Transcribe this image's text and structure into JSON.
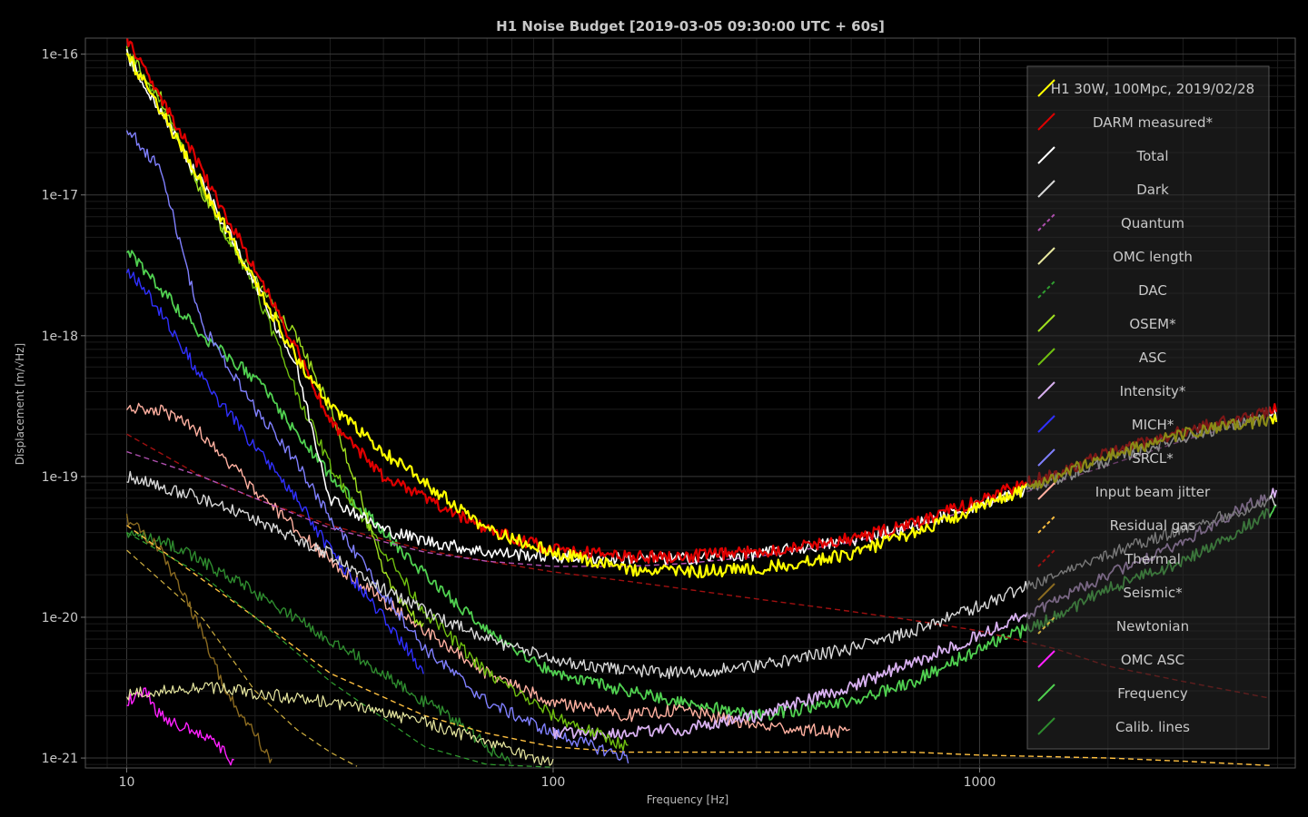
{
  "chart_data": {
    "type": "line",
    "title": "H1 Noise Budget [2019-03-05 09:30:00 UTC + 60s]",
    "xlabel": "Frequency [Hz]",
    "ylabel": "Displacement [m/√Hz]",
    "xscale": "log",
    "yscale": "log",
    "xlim": [
      8,
      5500
    ],
    "ylim": [
      8.5e-22,
      1.3e-16
    ],
    "grid": true,
    "legend_position": "right",
    "xticks": [
      {
        "value": 10,
        "label": "10"
      },
      {
        "value": 100,
        "label": "100"
      },
      {
        "value": 1000,
        "label": "1000"
      }
    ],
    "yticks": [
      {
        "value": 1e-21,
        "label": "1e-21"
      },
      {
        "value": 1e-20,
        "label": "1e-20"
      },
      {
        "value": 1e-19,
        "label": "1e-19"
      },
      {
        "value": 1e-18,
        "label": "1e-18"
      },
      {
        "value": 1e-17,
        "label": "1e-17"
      },
      {
        "value": 1e-16,
        "label": "1e-16"
      }
    ],
    "series": [
      {
        "name": "H1 30W, 100Mpc, 2019/02/28",
        "color": "#ffff00",
        "style": "solid",
        "width": 2.2,
        "x": [
          10,
          12,
          15,
          20,
          25,
          30,
          40,
          50,
          70,
          100,
          150,
          200,
          300,
          500,
          700,
          1000,
          1500,
          2000,
          3000,
          5000
        ],
        "y": [
          1e-16,
          4e-17,
          1.2e-17,
          2.4e-18,
          7e-19,
          3.2e-19,
          1.5e-19,
          9e-20,
          4.2e-20,
          2.9e-20,
          2.2e-20,
          2.1e-20,
          2.2e-20,
          2.8e-20,
          4e-20,
          6e-20,
          1e-19,
          1.4e-19,
          2e-19,
          2.6e-19
        ]
      },
      {
        "name": "DARM measured*",
        "color": "#e00000",
        "style": "solid",
        "width": 2.2,
        "x": [
          10,
          12,
          15,
          20,
          25,
          30,
          40,
          50,
          70,
          100,
          150,
          200,
          300,
          500,
          700,
          1000,
          1500,
          2000,
          3000,
          5000
        ],
        "y": [
          1.3e-16,
          5e-17,
          1.5e-17,
          3e-18,
          8e-19,
          2.5e-19,
          1e-19,
          7e-20,
          4.2e-20,
          3e-20,
          2.7e-20,
          2.7e-20,
          2.9e-20,
          3.6e-20,
          4.6e-20,
          6.8e-20,
          1.05e-19,
          1.45e-19,
          2.1e-19,
          3e-19
        ]
      },
      {
        "name": "Total",
        "color": "#ffffff",
        "style": "solid",
        "width": 1.6,
        "x": [
          10,
          15,
          20,
          25,
          30,
          40,
          50,
          70,
          100,
          150,
          200,
          300,
          500,
          700,
          1000,
          1500,
          2000,
          3000,
          5000
        ],
        "y": [
          1e-16,
          1.2e-17,
          2.4e-18,
          6e-19,
          7e-20,
          4.2e-20,
          3.5e-20,
          2.9e-20,
          2.7e-20,
          2.6e-20,
          2.6e-20,
          2.8e-20,
          3.5e-20,
          4.5e-20,
          6.3e-20,
          9.5e-20,
          1.3e-19,
          1.9e-19,
          2.8e-19
        ]
      },
      {
        "name": "Dark",
        "color": "#d8d8d8",
        "style": "solid",
        "width": 1.4,
        "x": [
          10,
          15,
          20,
          30,
          40,
          50,
          70,
          100,
          150,
          200,
          300,
          500,
          700,
          1000,
          1500,
          2000,
          3000,
          5000
        ],
        "y": [
          1e-19,
          7e-20,
          5e-20,
          2.8e-20,
          1.6e-20,
          1.1e-20,
          7e-21,
          5e-21,
          4.2e-21,
          4e-21,
          4.5e-21,
          6e-21,
          8e-21,
          1.2e-20,
          2e-20,
          2.8e-20,
          4.2e-20,
          7e-20
        ]
      },
      {
        "name": "Quantum",
        "color": "#b050b0",
        "style": "dashed",
        "width": 1.4,
        "x": [
          10,
          15,
          20,
          30,
          50,
          70,
          100,
          150,
          200,
          300,
          500,
          700,
          1000,
          1500,
          2000,
          3000,
          5000
        ],
        "y": [
          1.5e-19,
          1e-19,
          7e-20,
          4.3e-20,
          2.9e-20,
          2.5e-20,
          2.3e-20,
          2.3e-20,
          2.4e-20,
          2.7e-20,
          3.4e-20,
          4.4e-20,
          6.1e-20,
          9e-20,
          1.2e-19,
          1.8e-19,
          2.8e-19
        ]
      },
      {
        "name": "OMC length",
        "color": "#e8e8a0",
        "style": "solid",
        "width": 1.2,
        "x": [
          10,
          12,
          15,
          20,
          30,
          50,
          70,
          100
        ],
        "y": [
          2.8e-21,
          3e-21,
          3.2e-21,
          2.9e-21,
          2.5e-21,
          1.8e-21,
          1.3e-21,
          9e-22
        ]
      },
      {
        "name": "DAC",
        "color": "#30a030",
        "style": "dashed",
        "width": 1.2,
        "x": [
          10,
          15,
          20,
          30,
          50,
          70,
          100
        ],
        "y": [
          4e-20,
          2e-20,
          1e-20,
          3.5e-21,
          1.2e-21,
          9e-22,
          8.6e-22
        ]
      },
      {
        "name": "OSEM*",
        "color": "#a0e020",
        "style": "solid",
        "width": 1.4,
        "x": [
          10,
          12,
          15,
          20,
          25,
          30,
          35,
          40,
          50
        ],
        "y": [
          1.1e-16,
          5e-17,
          1e-17,
          2.5e-18,
          1e-18,
          3e-19,
          8e-20,
          2e-20,
          8e-21
        ]
      },
      {
        "name": "ASC",
        "color": "#70c010",
        "style": "solid",
        "width": 1.4,
        "x": [
          10,
          12,
          15,
          20,
          25,
          30,
          40,
          50,
          70,
          100,
          150
        ],
        "y": [
          1e-16,
          4.5e-17,
          1.1e-17,
          2.2e-18,
          4e-19,
          1.2e-19,
          3e-20,
          1.1e-20,
          4e-21,
          2e-21,
          1.2e-21
        ]
      },
      {
        "name": "Intensity*",
        "color": "#d8b0f0",
        "style": "solid",
        "width": 1.8,
        "x": [
          100,
          150,
          200,
          300,
          500,
          700,
          1000,
          1500,
          2000,
          3000,
          5000
        ],
        "y": [
          1.5e-21,
          1.5e-21,
          1.6e-21,
          2e-21,
          3.2e-21,
          4.8e-21,
          7.5e-21,
          1.3e-20,
          2e-20,
          3.5e-20,
          8e-20
        ]
      },
      {
        "name": "MICH*",
        "color": "#3030ff",
        "style": "solid",
        "width": 1.4,
        "x": [
          10,
          12,
          15,
          20,
          25,
          30,
          40,
          50
        ],
        "y": [
          3e-18,
          1.5e-18,
          5e-19,
          1.6e-19,
          7e-20,
          3e-20,
          1e-20,
          4e-21
        ]
      },
      {
        "name": "SRCL*",
        "color": "#8080ff",
        "style": "solid",
        "width": 1.4,
        "x": [
          10,
          12,
          15,
          20,
          25,
          30,
          40,
          50,
          70,
          100,
          150
        ],
        "y": [
          3e-17,
          1.5e-17,
          1.2e-18,
          3e-19,
          1.3e-19,
          5e-20,
          1.5e-20,
          6e-21,
          2.5e-21,
          1.5e-21,
          1e-21
        ]
      },
      {
        "name": "Input beam jitter",
        "color": "#ffb0a0",
        "style": "solid",
        "width": 1.4,
        "x": [
          10,
          12,
          15,
          20,
          30,
          50,
          70,
          100,
          150,
          200,
          300,
          500
        ],
        "y": [
          3e-19,
          3e-19,
          2e-19,
          8e-20,
          2.5e-20,
          8e-21,
          4e-21,
          2.5e-21,
          2e-21,
          2.2e-21,
          1.7e-21,
          1.5e-21
        ]
      },
      {
        "name": "Residual gas",
        "color": "#ffc040",
        "style": "dashed",
        "width": 1.4,
        "x": [
          10,
          20,
          30,
          50,
          70,
          100,
          150,
          200,
          300,
          500,
          700,
          1000,
          2000,
          3000,
          5000
        ],
        "y": [
          4.5e-20,
          1e-20,
          4e-21,
          2e-21,
          1.5e-21,
          1.2e-21,
          1.1e-21,
          1.1e-21,
          1.1e-21,
          1.1e-21,
          1.1e-21,
          1.05e-21,
          1e-21,
          9.5e-22,
          8.8e-22
        ]
      },
      {
        "name": "Thermal",
        "color": "#a01010",
        "style": "dashed",
        "width": 1.4,
        "x": [
          10,
          15,
          20,
          30,
          50,
          70,
          100,
          150,
          200,
          300,
          500,
          700,
          1000,
          1500,
          2000,
          3000,
          5000
        ],
        "y": [
          2e-19,
          1e-19,
          7e-20,
          4.5e-20,
          3e-20,
          2.5e-20,
          2.1e-20,
          1.8e-20,
          1.6e-20,
          1.35e-20,
          1.1e-20,
          9.5e-21,
          8e-21,
          6e-21,
          4.5e-21,
          3.5e-21,
          2.6e-21
        ]
      },
      {
        "name": "Seismic*",
        "color": "#8a6a20",
        "style": "solid",
        "width": 1.4,
        "x": [
          10,
          12,
          15,
          17,
          20,
          22
        ],
        "y": [
          5e-20,
          3e-20,
          8e-21,
          3e-21,
          1.5e-21,
          9e-22
        ]
      },
      {
        "name": "Newtonian",
        "color": "#d0b040",
        "style": "dashed",
        "width": 1.2,
        "x": [
          10,
          15,
          20,
          25,
          30,
          35
        ],
        "y": [
          3e-20,
          1e-20,
          3e-21,
          1.6e-21,
          1.1e-21,
          8.6e-22
        ]
      },
      {
        "name": "OMC ASC",
        "color": "#ff20ff",
        "style": "solid",
        "width": 1.4,
        "x": [
          10,
          11,
          12,
          14,
          16,
          18
        ],
        "y": [
          2.5e-21,
          3e-21,
          2e-21,
          1.6e-21,
          1.3e-21,
          9e-22
        ]
      },
      {
        "name": "Frequency",
        "color": "#50d050",
        "style": "solid",
        "width": 1.8,
        "x": [
          10,
          15,
          20,
          30,
          50,
          70,
          100,
          150,
          200,
          300,
          500,
          700,
          1000,
          1500,
          2000,
          3000,
          5000
        ],
        "y": [
          4e-18,
          1e-18,
          5e-19,
          1e-19,
          2e-20,
          8e-21,
          4e-21,
          3e-21,
          2.5e-21,
          2e-21,
          2.5e-21,
          3.5e-21,
          6e-21,
          1e-20,
          1.6e-20,
          2.5e-20,
          6e-20
        ]
      },
      {
        "name": "Calib. lines",
        "color": "#2e8b2e",
        "style": "solid",
        "width": 1.4,
        "x": [
          10,
          12,
          15,
          20,
          30,
          40,
          50,
          60,
          70,
          80
        ],
        "y": [
          4e-20,
          3.5e-20,
          2.5e-20,
          1.5e-20,
          7e-21,
          4e-21,
          2.5e-21,
          1.8e-21,
          1.2e-21,
          9e-22
        ]
      }
    ]
  }
}
